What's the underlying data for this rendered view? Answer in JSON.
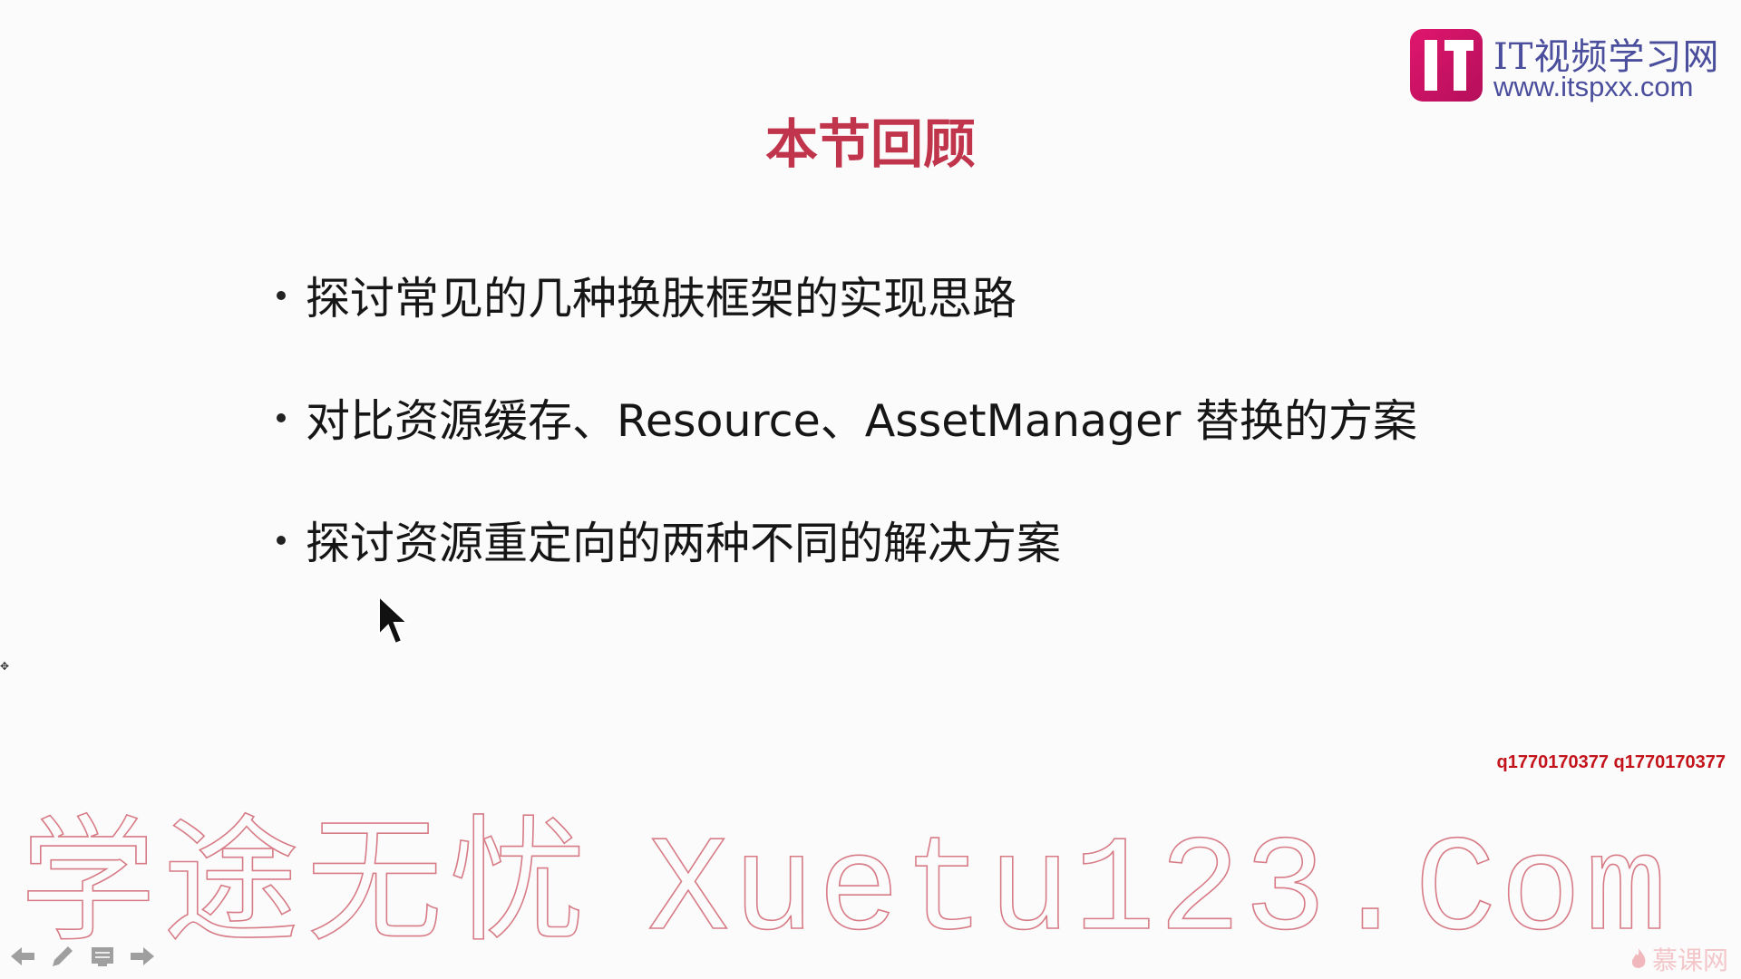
{
  "logo": {
    "title": "IT视频学习网",
    "url": "www.itspxx.com",
    "colors": {
      "mark": "#d2156a",
      "text": "#4a4e9c"
    }
  },
  "slide": {
    "title": "本节回顾",
    "bullets": [
      "探讨常见的几种换肤框架的实现思路",
      "对比资源缓存、Resource、AssetManager 替换的方案",
      "探讨资源重定向的两种不同的解决方案"
    ]
  },
  "qq": "q1770170377 q1770170377",
  "watermark": {
    "cn": "学途无忧",
    "en": "Xuetu123.Com"
  },
  "brand_small": "慕课网",
  "nav": {
    "controls": [
      "arrow-left-icon",
      "pen-icon",
      "slide-menu-icon",
      "arrow-right-icon"
    ]
  },
  "colors": {
    "title": "#c0344c",
    "qq": "#c4141b",
    "watermark": "#d77b86"
  }
}
